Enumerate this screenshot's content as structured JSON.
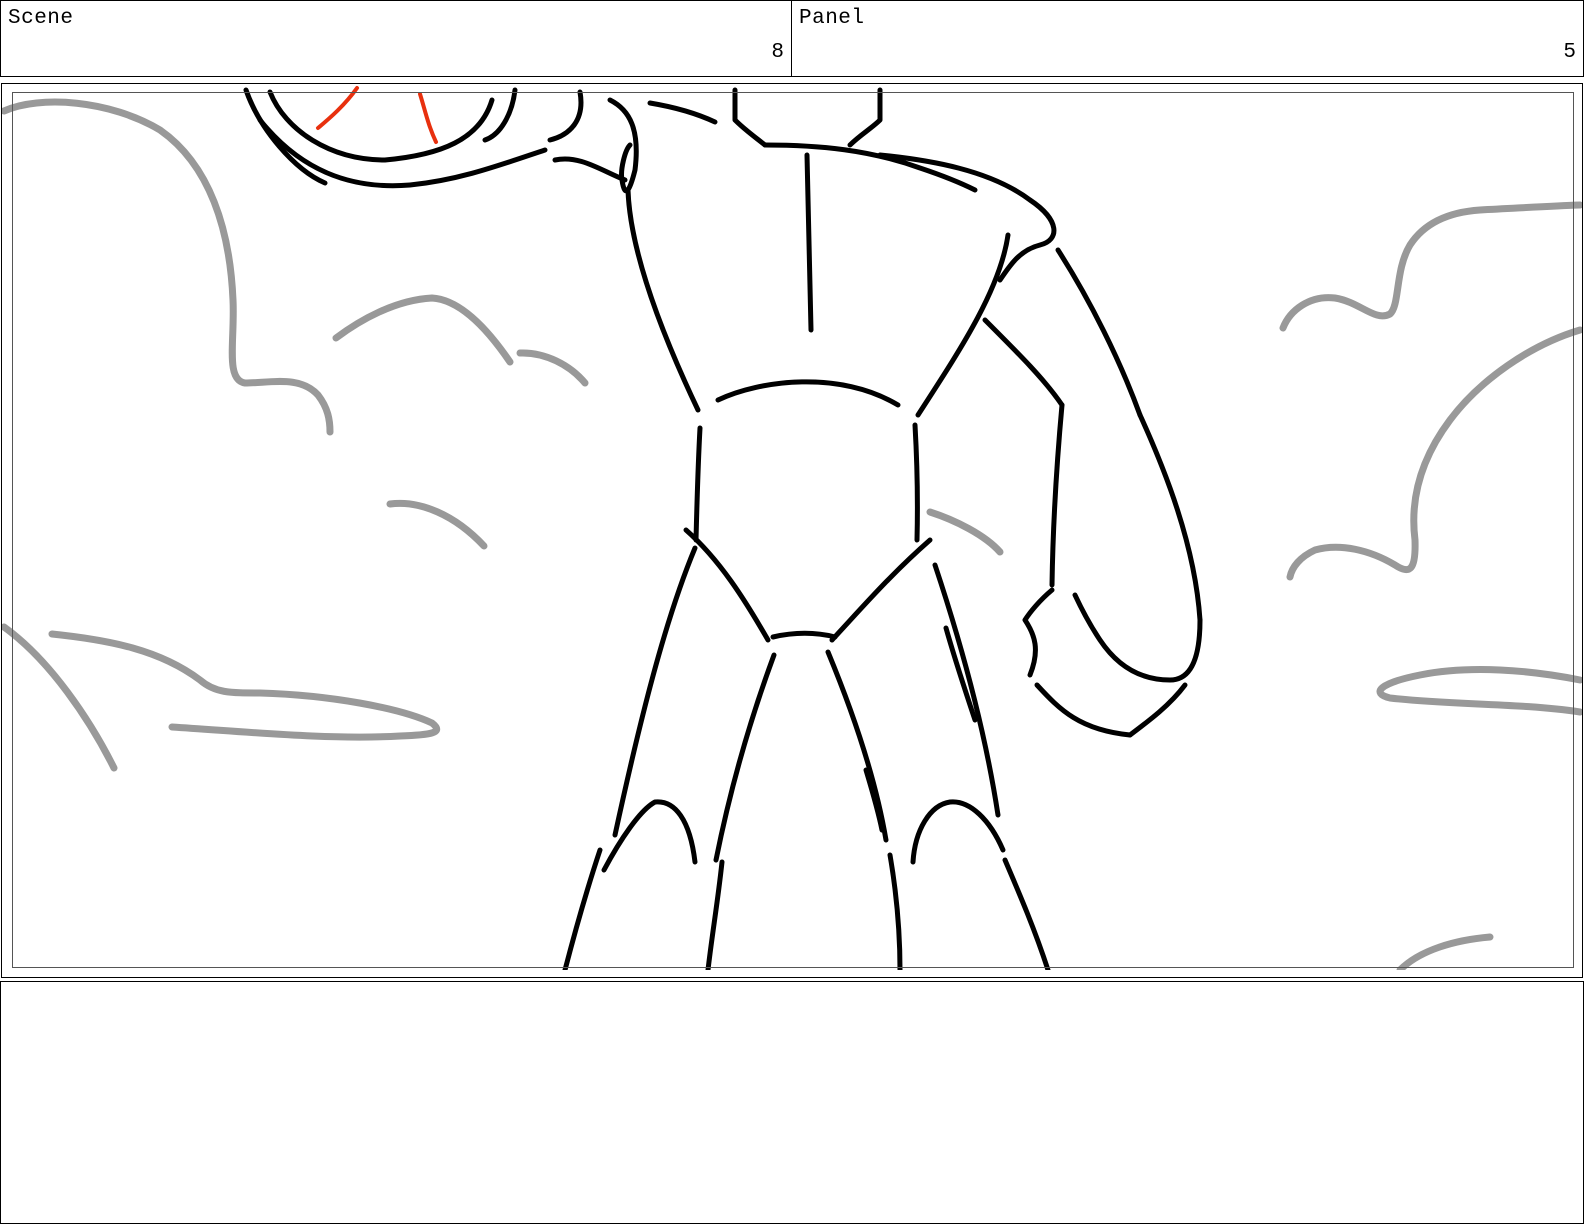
{
  "header": {
    "scene_label": "Scene",
    "scene_number": "8",
    "panel_label": "Panel",
    "panel_number": "5"
  },
  "colors": {
    "sketch_line": "#000000",
    "cloud_line": "#999999",
    "accent_line": "#e8300e",
    "border": "#000000"
  },
  "panel": {
    "description_icon": "robot-back-view-sketch",
    "background_icon": "cloud-sketch"
  },
  "notes": {
    "text": ""
  }
}
